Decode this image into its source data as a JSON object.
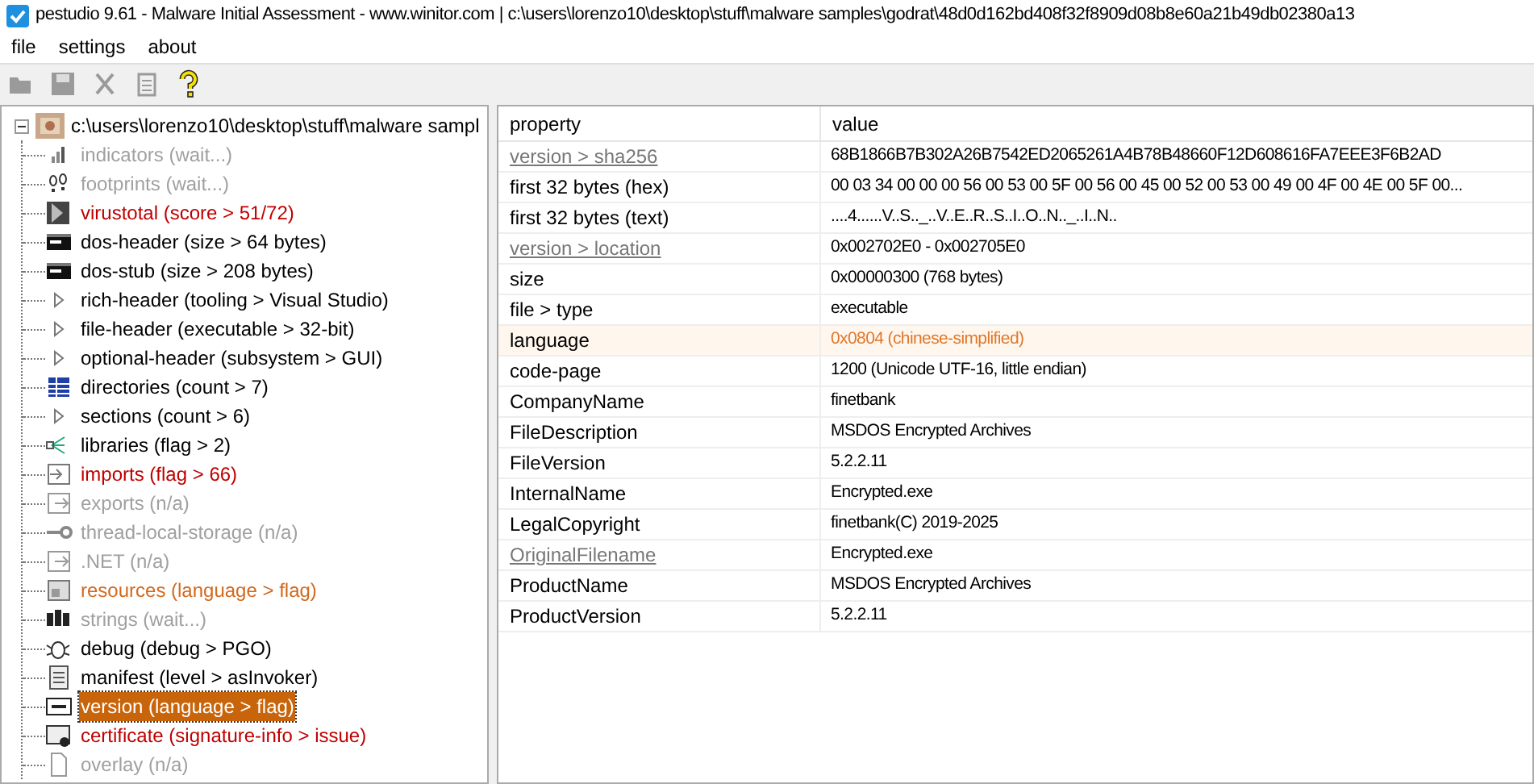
{
  "window": {
    "title": "pestudio 9.61 - Malware Initial Assessment - www.winitor.com | c:\\users\\lorenzo10\\desktop\\stuff\\malware samples\\godrat\\48d0d162bd408f32f8909d08b8e60a21b49db02380a13"
  },
  "menu": [
    "file",
    "settings",
    "about"
  ],
  "toolbar": [
    {
      "disabled": true
    },
    {
      "disabled": true
    },
    {
      "disabled": true
    },
    {
      "disabled": true
    },
    {
      "disabled": false
    }
  ],
  "tree": {
    "label": "c:\\users\\lorenzo10\\desktop\\stuff\\malware sampl",
    "expanded": true,
    "children": [
      {
        "label": "indicators (wait...)",
        "kind": "disabled",
        "selected": false
      },
      {
        "label": "footprints (wait...)",
        "kind": "disabled",
        "selected": false
      },
      {
        "label": "virustotal (score > 51/72)",
        "kind": "flagged",
        "selected": false
      },
      {
        "label": "dos-header (size > 64 bytes)",
        "kind": "normal",
        "selected": false
      },
      {
        "label": "dos-stub (size > 208 bytes)",
        "kind": "normal",
        "selected": false
      },
      {
        "label": "rich-header (tooling > Visual Studio)",
        "kind": "normal",
        "selected": false
      },
      {
        "label": "file-header (executable > 32-bit)",
        "kind": "normal",
        "selected": false
      },
      {
        "label": "optional-header (subsystem > GUI)",
        "kind": "normal",
        "selected": false
      },
      {
        "label": "directories (count > 7)",
        "kind": "normal",
        "selected": false
      },
      {
        "label": "sections (count > 6)",
        "kind": "normal",
        "selected": false
      },
      {
        "label": "libraries (flag > 2)",
        "kind": "normal",
        "selected": false
      },
      {
        "label": "imports (flag > 66)",
        "kind": "flagged",
        "selected": false
      },
      {
        "label": "exports (n/a)",
        "kind": "disabled",
        "selected": false
      },
      {
        "label": "thread-local-storage (n/a)",
        "kind": "disabled",
        "selected": false
      },
      {
        "label": ".NET (n/a)",
        "kind": "disabled",
        "selected": false
      },
      {
        "label": "resources (language > flag)",
        "kind": "warning",
        "selected": false
      },
      {
        "label": "strings (wait...)",
        "kind": "disabled",
        "selected": false
      },
      {
        "label": "debug (debug > PGO)",
        "kind": "normal",
        "selected": false
      },
      {
        "label": "manifest (level > asInvoker)",
        "kind": "normal",
        "selected": false
      },
      {
        "label": "version (language > flag)",
        "kind": "warning",
        "selected": true
      },
      {
        "label": "certificate (signature-info > issue)",
        "kind": "flagged",
        "selected": false
      },
      {
        "label": "overlay (n/a)",
        "kind": "disabled",
        "selected": false
      }
    ]
  },
  "table": {
    "columns": [
      "property",
      "value"
    ],
    "rows": [
      {
        "property": "version > sha256",
        "link": true,
        "value": "68B1866B7B302A26B7542ED2065261A4B78B48660F12D608616FA7EEE3F6B2AD",
        "flagged": false
      },
      {
        "property": "first 32 bytes (hex)",
        "link": false,
        "value": "00 03 34 00 00 00 56 00 53 00 5F 00 56 00 45 00 52 00 53 00 49 00 4F 00 4E 00 5F 00...",
        "flagged": false
      },
      {
        "property": "first 32 bytes (text)",
        "link": false,
        "value": "....4......V..S.._..V..E..R..S..I..O..N.._..I..N..",
        "flagged": false
      },
      {
        "property": "version > location",
        "link": true,
        "value": "0x002702E0 - 0x002705E0",
        "flagged": false
      },
      {
        "property": "size",
        "link": false,
        "value": "0x00000300 (768 bytes)",
        "flagged": false
      },
      {
        "property": "file > type",
        "link": false,
        "value": "executable",
        "flagged": false
      },
      {
        "property": "language",
        "link": false,
        "value": "0x0804 (chinese-simplified)",
        "flagged": true
      },
      {
        "property": "code-page",
        "link": false,
        "value": "1200 (Unicode UTF-16, little endian)",
        "flagged": false
      },
      {
        "property": "CompanyName",
        "link": false,
        "value": "finetbank",
        "flagged": false
      },
      {
        "property": "FileDescription",
        "link": false,
        "value": "MSDOS Encrypted Archives",
        "flagged": false
      },
      {
        "property": "FileVersion",
        "link": false,
        "value": "5.2.2.11",
        "flagged": false
      },
      {
        "property": "InternalName",
        "link": false,
        "value": "Encrypted.exe",
        "flagged": false
      },
      {
        "property": "LegalCopyright",
        "link": false,
        "value": "finetbank(C) 2019-2025",
        "flagged": false
      },
      {
        "property": "OriginalFilename",
        "link": true,
        "value": "Encrypted.exe",
        "flagged": false
      },
      {
        "property": "ProductName",
        "link": false,
        "value": "MSDOS Encrypted Archives",
        "flagged": false
      },
      {
        "property": "ProductVersion",
        "link": false,
        "value": "5.2.2.11",
        "flagged": false
      }
    ]
  }
}
